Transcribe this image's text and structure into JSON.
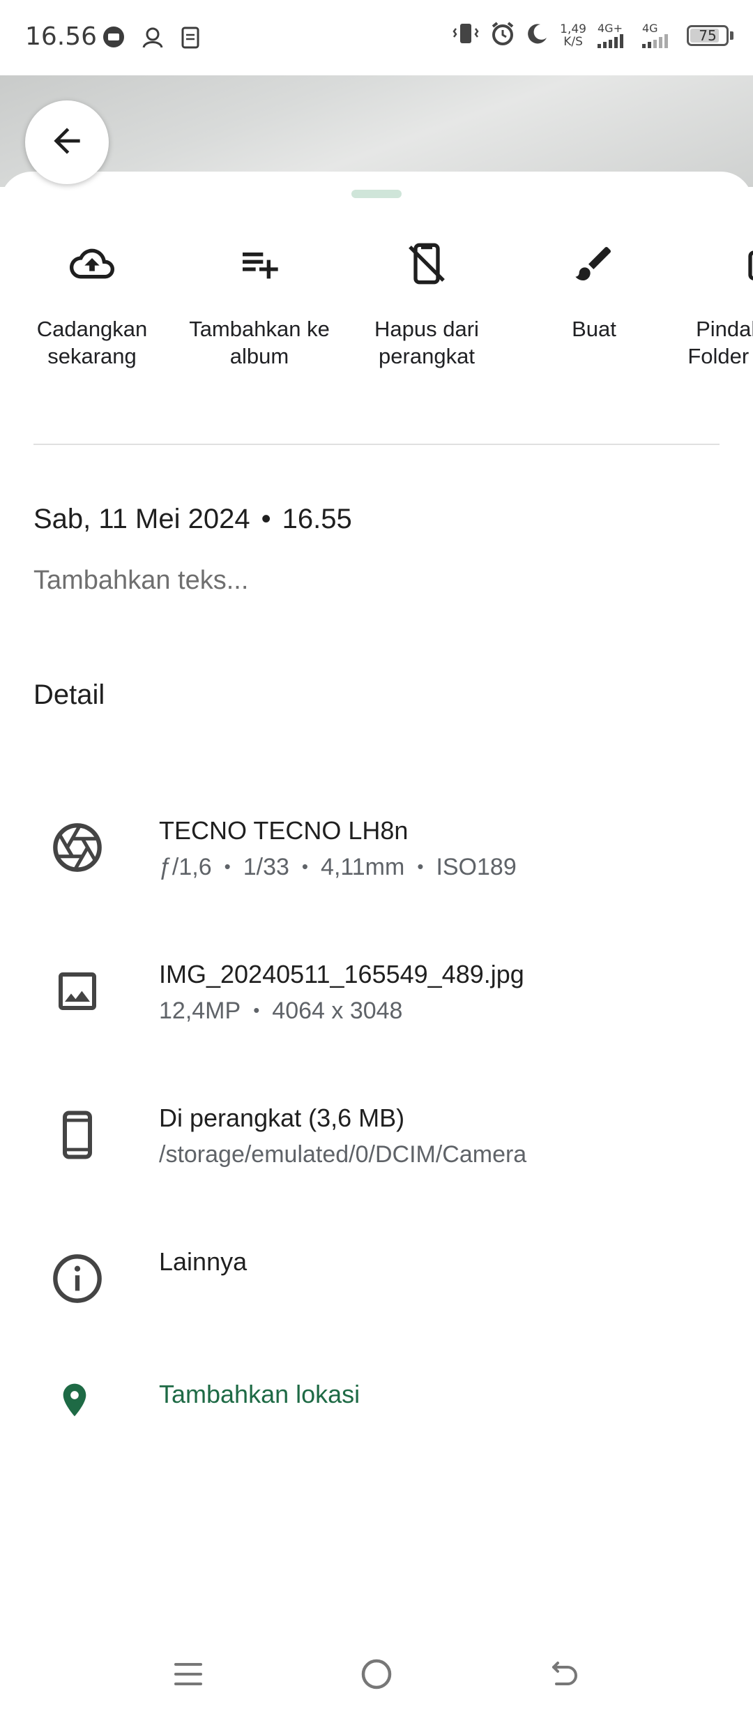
{
  "status_bar": {
    "time": "16.56",
    "speed_value": "1,49",
    "speed_unit": "K/S",
    "net1": "4G+",
    "net2": "4G",
    "battery": "75"
  },
  "actions": [
    {
      "icon": "cloud-upload-icon",
      "label": "Cadangkan sekarang"
    },
    {
      "icon": "playlist-add-icon",
      "label": "Tambahkan ke album"
    },
    {
      "icon": "remove-from-device-icon",
      "label": "Hapus dari perangkat"
    },
    {
      "icon": "brush-icon",
      "label": "Buat"
    },
    {
      "icon": "move-icon",
      "label": "Pindahkan ke Folder Terkunci"
    }
  ],
  "date": "Sab, 11 Mei 2024",
  "time": "16.55",
  "add_text_placeholder": "Tambahkan teks...",
  "detail_heading": "Detail",
  "details": {
    "camera": {
      "title": "TECNO TECNO LH8n",
      "aperture": "ƒ/1,6",
      "shutter": "1/33",
      "focal": "4,11mm",
      "iso": "ISO189"
    },
    "file": {
      "title": "IMG_20240511_165549_489.jpg",
      "megapixels": "12,4MP",
      "resolution": "4064 x 3048"
    },
    "storage": {
      "title": "Di perangkat (3,6 MB)",
      "path": "/storage/emulated/0/DCIM/Camera"
    },
    "more": {
      "title": "Lainnya"
    },
    "location": {
      "label": "Tambahkan lokasi"
    }
  },
  "colors": {
    "accent_green": "#1e6a45",
    "handle": "#cfe5d9"
  }
}
